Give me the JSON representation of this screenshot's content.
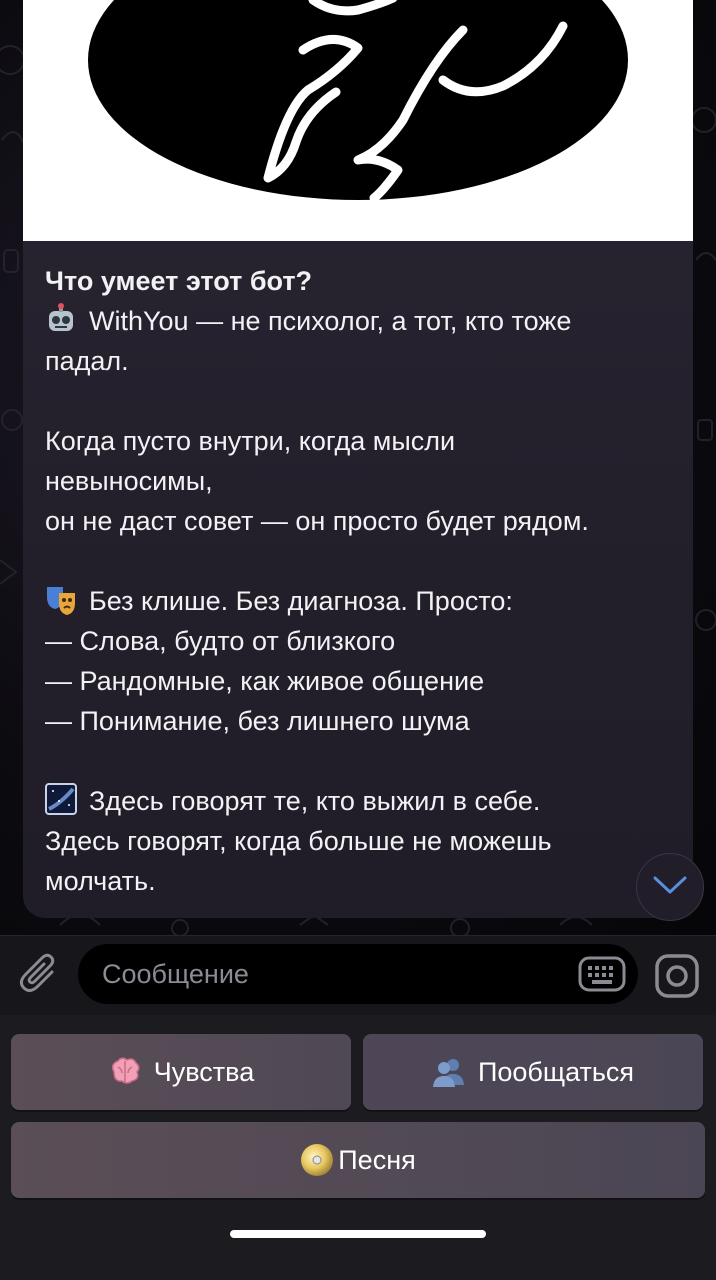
{
  "intro": {
    "title": "Что умеет этот бот?",
    "lines": [
      "WithYou — не психолог, а тот, кто тоже",
      "падал.",
      "Когда пусто внутри, когда мысли",
      "невыносимы,",
      "он не даст совет — он просто будет рядом.",
      "Без клише. Без диагноза. Просто:",
      "— Слова, будто от близкого",
      "— Рандомные, как живое общение",
      "— Понимание, без лишнего шума",
      "Здесь говорят те, кто выжил в себе.",
      "Здесь говорят, когда больше не можешь",
      "молчать."
    ],
    "emojis": [
      "robot-face",
      "performing-arts",
      "milky-way"
    ]
  },
  "input": {
    "placeholder": "Сообщение"
  },
  "keyboard": {
    "buttons": [
      {
        "label": "Чувства",
        "icon": "brain-emoji"
      },
      {
        "label": "Пообщаться",
        "icon": "busts-in-silhouette-emoji"
      },
      {
        "label": "Песня",
        "icon": "dvd-emoji"
      }
    ]
  }
}
